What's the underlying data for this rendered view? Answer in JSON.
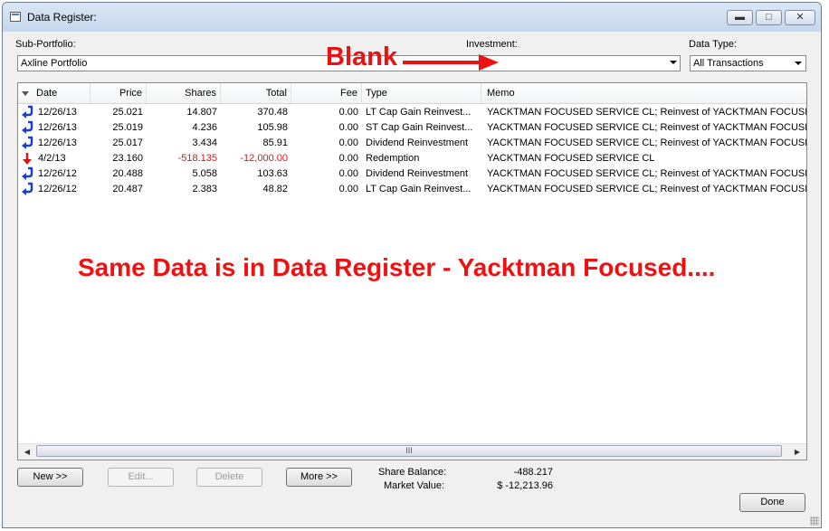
{
  "window": {
    "title": "Data Register:"
  },
  "controls": {
    "sub_portfolio_label": "Sub-Portfolio:",
    "sub_portfolio_value": "Axline Portfolio",
    "investment_label": "Investment:",
    "investment_value": "",
    "data_type_label": "Data Type:",
    "data_type_value": "All Transactions"
  },
  "grid": {
    "columns": [
      "Date",
      "Price",
      "Shares",
      "Total",
      "Fee",
      "Type",
      "Memo"
    ],
    "rows": [
      {
        "icon": "reinvest",
        "date": "12/26/13",
        "price": "25.021",
        "shares": "14.807",
        "total": "370.48",
        "fee": "0.00",
        "type": "LT Cap Gain Reinvest...",
        "memo": "YACKTMAN FOCUSED SERVICE CL; Reinvest of YACKTMAN FOCUSE..."
      },
      {
        "icon": "reinvest",
        "date": "12/26/13",
        "price": "25.019",
        "shares": "4.236",
        "total": "105.98",
        "fee": "0.00",
        "type": "ST Cap Gain Reinvest...",
        "memo": "YACKTMAN FOCUSED SERVICE CL; Reinvest of YACKTMAN FOCUSE..."
      },
      {
        "icon": "reinvest",
        "date": "12/26/13",
        "price": "25.017",
        "shares": "3.434",
        "total": "85.91",
        "fee": "0.00",
        "type": "Dividend Reinvestment",
        "memo": "YACKTMAN FOCUSED SERVICE CL; Reinvest of YACKTMAN FOCUSE..."
      },
      {
        "icon": "redemption",
        "date": "4/2/13",
        "price": "23.160",
        "shares": "-518.135",
        "total": "-12,000.00",
        "fee": "0.00",
        "type": "Redemption",
        "memo": "YACKTMAN FOCUSED SERVICE CL",
        "negative": true
      },
      {
        "icon": "reinvest",
        "date": "12/26/12",
        "price": "20.488",
        "shares": "5.058",
        "total": "103.63",
        "fee": "0.00",
        "type": "Dividend Reinvestment",
        "memo": "YACKTMAN FOCUSED SERVICE CL; Reinvest of YACKTMAN FOCUSE..."
      },
      {
        "icon": "reinvest",
        "date": "12/26/12",
        "price": "20.487",
        "shares": "2.383",
        "total": "48.82",
        "fee": "0.00",
        "type": "LT Cap Gain Reinvest...",
        "memo": "YACKTMAN FOCUSED SERVICE CL; Reinvest of YACKTMAN FOCUSE..."
      }
    ],
    "scroll_grip": "III"
  },
  "buttons": {
    "new": "New >>",
    "edit": "Edit...",
    "delete": "Delete",
    "more": "More >>",
    "done": "Done"
  },
  "summary": {
    "share_balance_label": "Share Balance:",
    "share_balance_value": "-488.217",
    "market_value_label": "Market Value:",
    "market_value_value": "$ -12,213.96"
  },
  "annotations": {
    "blank": "Blank",
    "note": "Same Data is in Data Register - Yacktman Focused...."
  },
  "colors": {
    "annotation": "#ee1111",
    "negative": "#d01818",
    "icon_blue": "#1840c8"
  }
}
